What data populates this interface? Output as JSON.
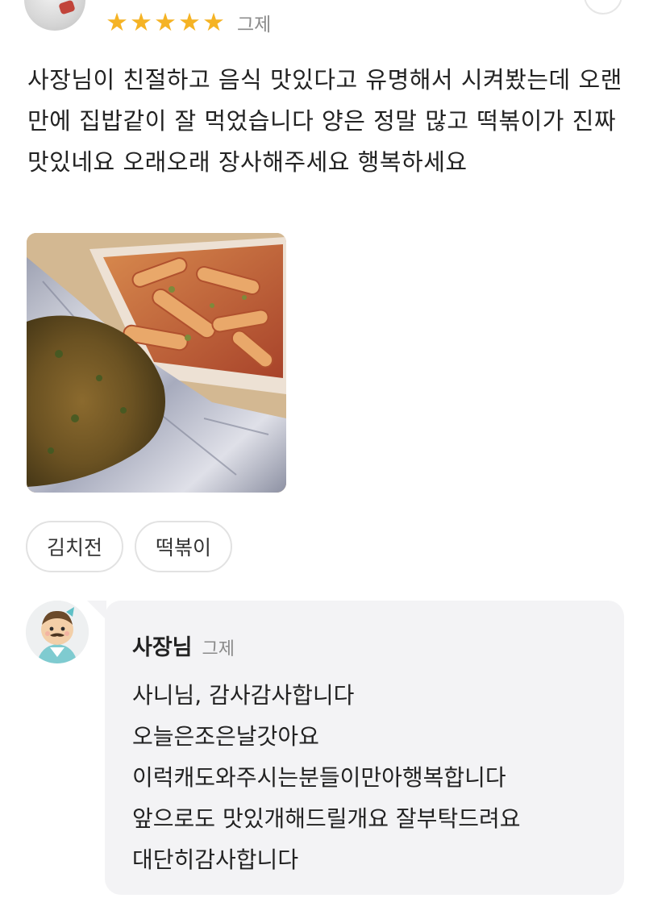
{
  "review": {
    "rating": 5,
    "star_glyph": "★",
    "star_color": "#f5b324",
    "date": "그제",
    "text": "사장님이 친절하고 음식 맛있다고 유명해서 시켜봤는데 오랜만에 집밥같이 잘 먹었습니다 양은 정말 많고 떡볶이가 진짜 맛있네요 오래오래 장사해주세요 행복하세요",
    "photo_icon": "food-photo",
    "tags": [
      "김치전",
      "떡볶이"
    ]
  },
  "owner_reply": {
    "name": "사장님",
    "date": "그제",
    "lines": [
      "사니님, 감사감사합니다",
      "오늘은조은날갓아요",
      "이럭캐도와주시는분들이만아행복합니다",
      "앞으로도 맛있개해드릴개요 잘부탁드려요",
      "대단히감사합니다"
    ]
  }
}
